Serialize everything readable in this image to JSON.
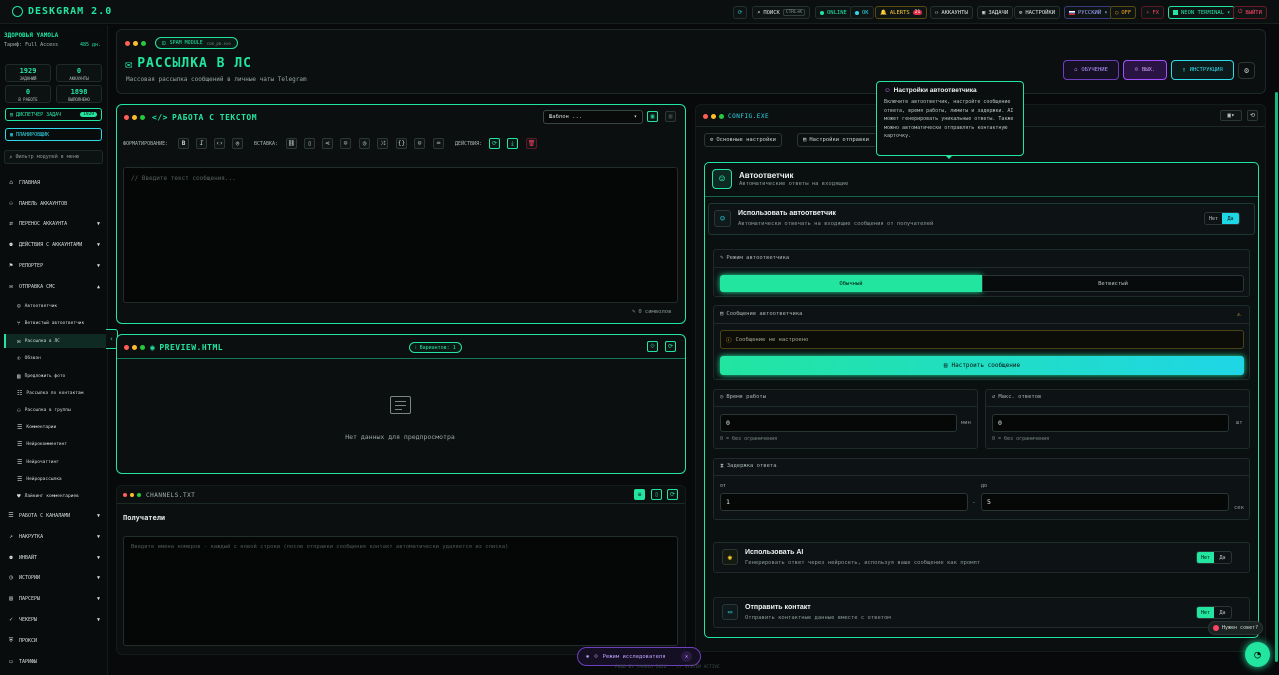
{
  "app": {
    "title": "DESKGRAM 2.0"
  },
  "topbar": {
    "search_label": "ПОИСК",
    "search_kbd": "CTRL+K",
    "online": "ONLINE",
    "ok": "OK",
    "alerts": "ALERTS",
    "alerts_count": "21",
    "accounts": "АККАУНТЫ",
    "tasks": "ЗАДАЧИ",
    "settings": "НАСТРОЙКИ",
    "language": "РУССКИЙ",
    "off": "OFF",
    "fx": "FX",
    "terminal": "NEON TERMINAL",
    "logout": "ВЫЙТИ"
  },
  "sidebar": {
    "user": "ЗДОРОВЬЯ YAMOLA",
    "plan_label": "Тариф: Full Access",
    "plan_days": "485 дн.",
    "stats": [
      {
        "value": "1929",
        "label": "ЗАДАНИЙ"
      },
      {
        "value": "0",
        "label": "АККАУНТЫ"
      },
      {
        "value": "0",
        "label": "В РАБОТЕ"
      },
      {
        "value": "1898",
        "label": "ВЫПОЛНЕНО"
      }
    ],
    "dispatcher": "ДИСПЕТЧЕР ЗАДАЧ",
    "dispatcher_badge": "1929",
    "planner": "ПЛАНИРОВЩИК",
    "filter_placeholder": "Фильтр модулей в меню",
    "menu": [
      {
        "label": "ГЛАВНАЯ",
        "icon": "home-icon"
      },
      {
        "label": "ПАНЕЛЬ АККАУНТОВ",
        "icon": "users-icon"
      },
      {
        "label": "ПЕРЕНОС АККАУНТА",
        "icon": "transfer-icon"
      },
      {
        "label": "ДЕЙСТВИЯ С АККАУНТАМИ",
        "icon": "user-plus-icon"
      },
      {
        "label": "РЕПОРТЕР",
        "icon": "flag-icon"
      },
      {
        "label": "ОТПРАВКА СМС",
        "icon": "message-icon"
      }
    ],
    "submenu": [
      {
        "label": "Автоответчик",
        "icon": "robot-icon"
      },
      {
        "label": "Ветвистый автоответчик",
        "icon": "branch-icon"
      },
      {
        "label": "Рассылка в ЛС",
        "icon": "mail-icon"
      },
      {
        "label": "Обзвон",
        "icon": "phone-icon"
      },
      {
        "label": "Предложить фото",
        "icon": "image-icon"
      },
      {
        "label": "Рассылка по контактам",
        "icon": "contacts-icon"
      },
      {
        "label": "Рассылка в группы",
        "icon": "group-icon"
      },
      {
        "label": "Комментарии",
        "icon": "comment-icon"
      },
      {
        "label": "Нейрокомментинг",
        "icon": "neuro-comment-icon"
      },
      {
        "label": "Нейрочаттинг",
        "icon": "neuro-chat-icon"
      },
      {
        "label": "Нейрорассылка",
        "icon": "neuro-mail-icon"
      },
      {
        "label": "Лайкинг комментариев",
        "icon": "heart-icon"
      }
    ],
    "menu2": [
      {
        "label": "РАБОТА С КАНАЛАМИ",
        "icon": "channel-icon"
      },
      {
        "label": "НАКРУТКА",
        "icon": "boost-icon"
      },
      {
        "label": "ИНВАЙТ",
        "icon": "invite-icon"
      },
      {
        "label": "ИСТОРИИ",
        "icon": "stories-icon"
      },
      {
        "label": "ПАРСЕРЫ",
        "icon": "parser-icon"
      },
      {
        "label": "ЧЕКЕРЫ",
        "icon": "checker-icon"
      },
      {
        "label": "ПРОКСИ",
        "icon": "shield-icon"
      },
      {
        "label": "ТАРИФЫ",
        "icon": "tariff-icon"
      }
    ]
  },
  "header": {
    "module_badge": "SPAM MODULE",
    "module_sub": "com_pm.exe",
    "title": "РАССЫЛКА В ЛС",
    "subtitle": "Массовая рассылка сообщений в личные чаты Telegram",
    "btn_training": "ОБУЧЕНИЕ",
    "btn_exit": "ВЫХ.",
    "btn_instruction": "ИНСТРУКЦИЯ"
  },
  "editor": {
    "title": "РАБОТА С ТЕКСТОМ",
    "template_select": "Шаблон ...",
    "format_label": "ФОРМАТИРОВАНИЕ:",
    "insert_label": "ВСТАВКА:",
    "actions_label": "ДЕЙСТВИЯ:",
    "placeholder": "// Введите текст сообщения...",
    "char_count": "0 символов"
  },
  "preview": {
    "title": "PREVIEW.HTML",
    "variants": "Вариантов: 1",
    "empty": "Нет данных для предпросмотра"
  },
  "channels": {
    "title": "CHANNELS.TXT",
    "recipients_label": "Получатели",
    "placeholder": "Введите имена номеров - каждый с новой строки (после отправки сообщения контакт автоматически удаляется из списка)"
  },
  "config": {
    "title": "CONFIG.EXE",
    "tab_basic": "Основные настройки",
    "tab_send": "Настройки отправки",
    "tooltip_title": "Настройки автоответчика",
    "tooltip_text": "Включите автоответчик, настройте сообщение ответа, время работы, лимиты и задержки. AI может генерировать уникальные ответы. Также можно автоматически отправлять контактную карточку.",
    "auto_title": "Автоответчик",
    "auto_sub": "Автоматические ответы на входящие",
    "use_title": "Использовать автоответчик",
    "use_sub": "Автоматически отвечать на входящие сообщения от получателей",
    "no": "Нет",
    "yes": "Да",
    "mode_label": "Режим автоответчика",
    "mode_normal": "Обычный",
    "mode_branch": "Ветвистый",
    "msg_label": "Сообщение автоответчика",
    "msg_empty": "Сообщение не настроено",
    "msg_btn": "Настроить сообщение",
    "worktime_label": "Время работы",
    "worktime_value": "0",
    "worktime_unit": "мин",
    "worktime_hint": "0 = без ограничения",
    "maxreply_label": "Макс. ответов",
    "maxreply_value": "0",
    "maxreply_unit": "шт",
    "maxreply_hint": "0 = без ограничения",
    "delay_label": "Задержка ответа",
    "delay_from": "от",
    "delay_to": "до",
    "delay_from_value": "1",
    "delay_to_value": "5",
    "delay_unit": "сек",
    "ai_title": "Использовать AI",
    "ai_sub": "Генерировать ответ через нейросеть, используя ваше сообщение как промпт",
    "contact_title": "Отправить контакт",
    "contact_sub": "Отправить контактные данные вместе с ответом"
  },
  "footer": {
    "research": "Режим исследователя",
    "credit": "PROD BY YAMOLA 2026",
    "status": "// SYSTEM ACTIVE",
    "chat": "Нужен совет?"
  }
}
